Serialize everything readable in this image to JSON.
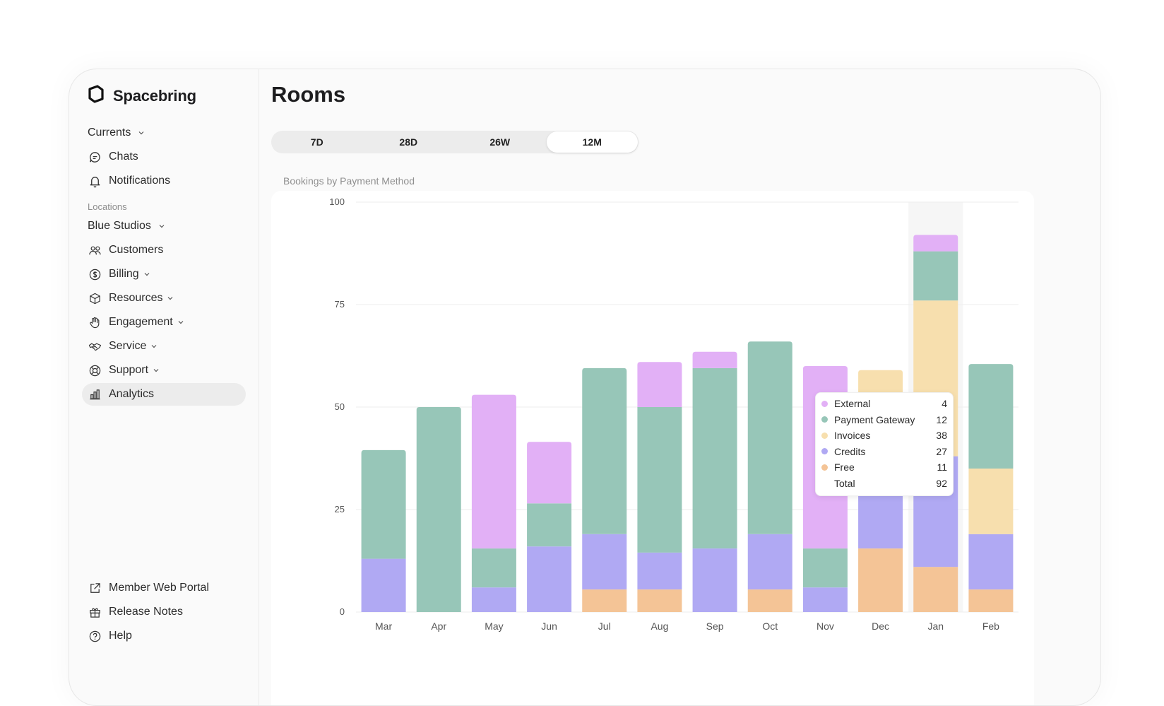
{
  "app": {
    "brand": "Spacebring"
  },
  "sidebar": {
    "currents_label": "Currents",
    "top_items": [
      {
        "label": "Chats",
        "icon": "chat-icon"
      },
      {
        "label": "Notifications",
        "icon": "bell-icon"
      }
    ],
    "locations_label": "Locations",
    "location_name": "Blue Studios",
    "location_items": [
      {
        "label": "Customers",
        "icon": "users-icon"
      },
      {
        "label": "Billing",
        "icon": "dollar-icon"
      },
      {
        "label": "Resources",
        "icon": "cube-icon"
      },
      {
        "label": "Engagement",
        "icon": "hand-icon"
      },
      {
        "label": "Service",
        "icon": "handshake-icon"
      },
      {
        "label": "Support",
        "icon": "lifebuoy-icon"
      },
      {
        "label": "Analytics",
        "icon": "bar-chart-icon"
      }
    ],
    "bottom_items": [
      {
        "label": "Member Web Portal",
        "icon": "external-link-icon"
      },
      {
        "label": "Release Notes",
        "icon": "gift-icon"
      },
      {
        "label": "Help",
        "icon": "help-icon"
      }
    ]
  },
  "page": {
    "title": "Rooms",
    "ranges": [
      "7D",
      "28D",
      "26W",
      "12M"
    ],
    "active_range": "12M",
    "chart_caption": "Bookings by Payment Method"
  },
  "colors": {
    "External": "#e2b0f6",
    "Payment Gateway": "#97c6b8",
    "Invoices": "#f7dfae",
    "Credits": "#b0a9f3",
    "Free": "#f4c496"
  },
  "tooltip": {
    "rows": [
      {
        "name": "External",
        "value": "4"
      },
      {
        "name": "Payment Gateway",
        "value": "12"
      },
      {
        "name": "Invoices",
        "value": "38"
      },
      {
        "name": "Credits",
        "value": "27"
      },
      {
        "name": "Free",
        "value": "11"
      }
    ],
    "total_label": "Total",
    "total_value": "92"
  },
  "chart_data": {
    "type": "bar",
    "stacked": true,
    "title": "Bookings by Payment Method",
    "categories": [
      "Mar",
      "Apr",
      "May",
      "Jun",
      "Jul",
      "Aug",
      "Sep",
      "Oct",
      "Nov",
      "Dec",
      "Jan",
      "Feb"
    ],
    "ylim": [
      0,
      100
    ],
    "yticks": [
      0,
      25,
      50,
      75,
      100
    ],
    "grid": true,
    "highlighted_category": "Jan",
    "series": [
      {
        "name": "Free",
        "values": [
          0,
          0,
          0,
          0,
          5.5,
          5.5,
          0,
          5.5,
          0,
          15.5,
          11,
          5.5
        ]
      },
      {
        "name": "Credits",
        "values": [
          13,
          0,
          6,
          16,
          13.5,
          9,
          15.5,
          13.5,
          6,
          20,
          27,
          13.5
        ]
      },
      {
        "name": "Invoices",
        "values": [
          0,
          0,
          0,
          0,
          0,
          0,
          0,
          0,
          0,
          23.5,
          38,
          16
        ]
      },
      {
        "name": "Payment Gateway",
        "values": [
          26.5,
          50,
          9.5,
          10.5,
          40.5,
          35.5,
          44,
          47,
          9.5,
          0,
          12,
          25.5
        ]
      },
      {
        "name": "External",
        "values": [
          0,
          0,
          37.5,
          15,
          0,
          11,
          4,
          0,
          44.5,
          0,
          4,
          0
        ]
      }
    ]
  }
}
